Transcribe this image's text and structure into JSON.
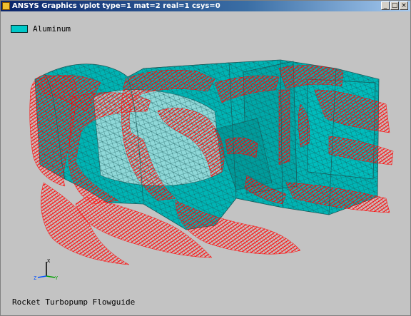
{
  "window": {
    "title": "ANSYS Graphics   vplot   type=1 mat=2 real=1 csys=0",
    "minimize_glyph": "_",
    "maximize_glyph": "□",
    "close_glyph": "×"
  },
  "legend": {
    "label": "Aluminum",
    "swatch_color": "#00c8c8"
  },
  "triad": {
    "x_label": "X",
    "y_label": "Y",
    "z_label": "Z"
  },
  "caption": "Rocket Turbopump Flowguide",
  "colors": {
    "background": "#c3c3c3",
    "mesh_fill": "#00b4b4",
    "mesh_lines": "#1a5a5a",
    "load_arrows": "#ff0000",
    "title_bar": "#0a246a"
  },
  "icons": {
    "app_icon": "ansys-app-icon",
    "minimize": "minimize-icon",
    "maximize": "maximize-icon",
    "close": "close-icon"
  }
}
